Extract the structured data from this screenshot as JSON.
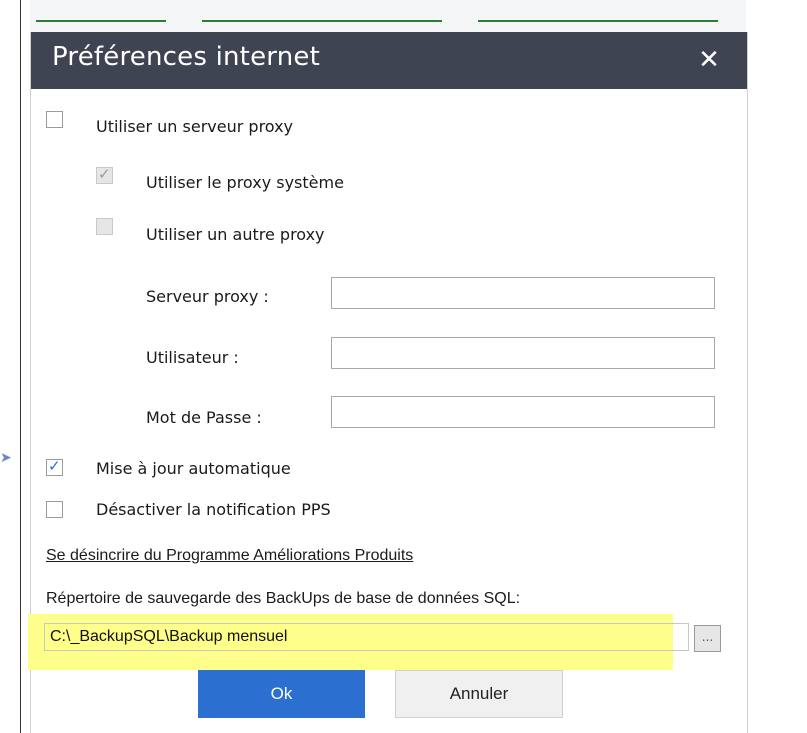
{
  "dialog": {
    "title": "Préférences internet",
    "close_glyph": "✕"
  },
  "options": {
    "use_proxy": {
      "label": "Utiliser un serveur proxy",
      "checked": false
    },
    "system_proxy": {
      "label": "Utiliser le proxy système",
      "checked": true,
      "disabled": true
    },
    "other_proxy": {
      "label": "Utiliser un autre proxy",
      "checked": false,
      "disabled": true
    },
    "auto_update": {
      "label": "Mise à jour automatique",
      "checked": true
    },
    "disable_pps": {
      "label": "Désactiver la notification PPS",
      "checked": false
    }
  },
  "proxy_fields": {
    "server_label": "Serveur proxy :",
    "server_value": "",
    "user_label": "Utilisateur :",
    "user_value": "",
    "password_label": "Mot de Passe :",
    "password_value": ""
  },
  "unsubscribe_link": "Se désincrire du Programme Améliorations Produits",
  "backup": {
    "label": "Répertoire de sauvegarde des BackUps de base de données SQL:",
    "path": "C:\\_BackupSQL\\Backup mensuel",
    "browse_glyph": "..."
  },
  "buttons": {
    "ok": "Ok",
    "cancel": "Annuler"
  },
  "colors": {
    "titlebar": "#3e4451",
    "accent": "#2b6fd1",
    "highlight": "#fefe8a"
  }
}
